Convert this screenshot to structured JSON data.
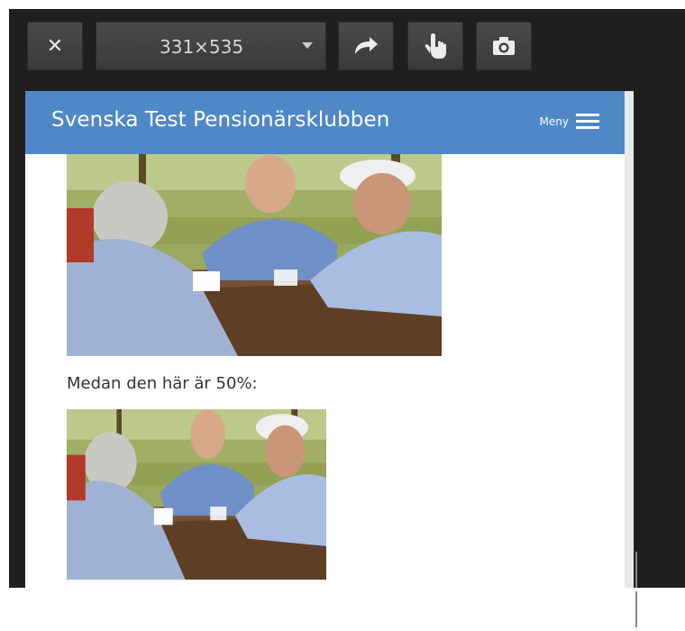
{
  "toolbar": {
    "close_label": "✕",
    "size_label": "331×535",
    "rotate_icon": "rotate-icon",
    "touch_icon": "touch-icon",
    "screenshot_icon": "camera-icon"
  },
  "app": {
    "title": "Svenska Test Pensionärsklubben",
    "menu_label": "Meny"
  },
  "content": {
    "caption": "Medan den här är 50%:"
  },
  "colors": {
    "header": "#4f88c6",
    "chrome": "#1f1f1f"
  }
}
